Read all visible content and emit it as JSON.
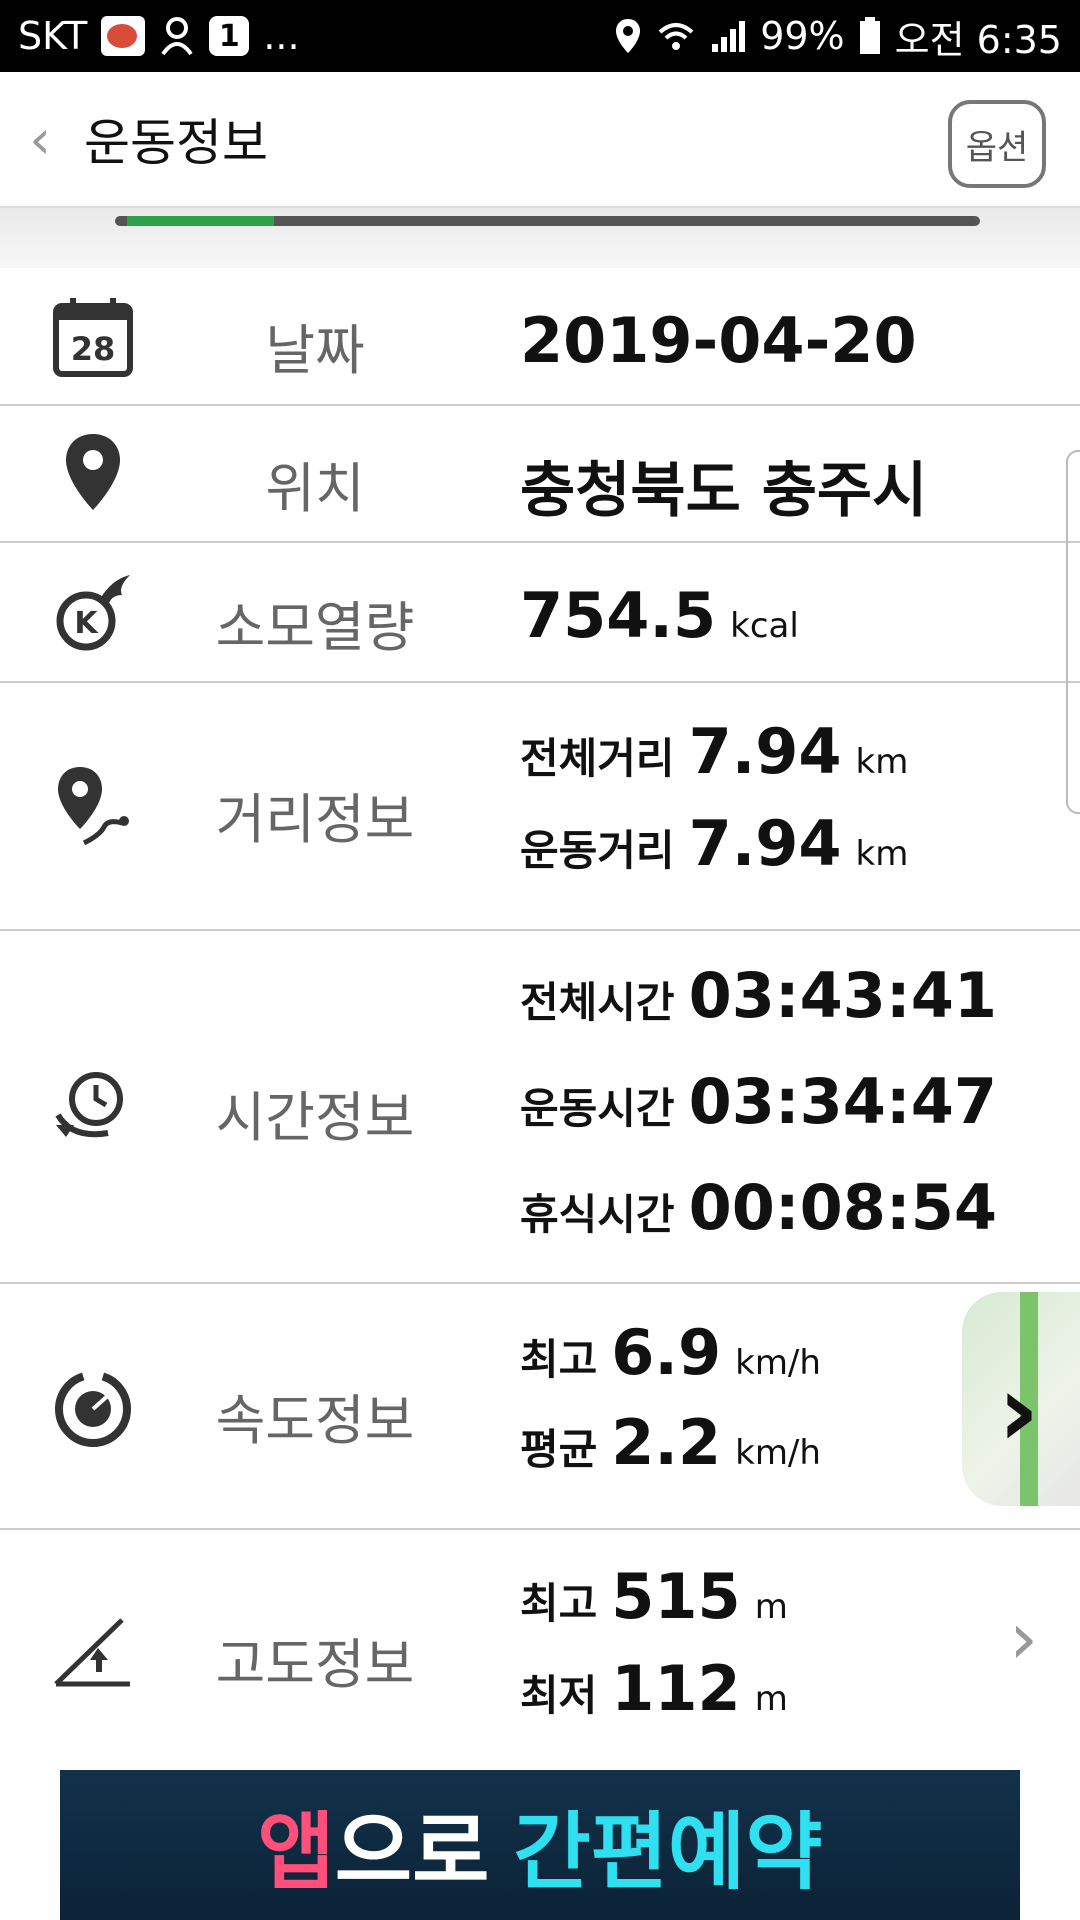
{
  "status_bar": {
    "carrier": "SKT",
    "badge_number": "1",
    "ellipsis": "...",
    "battery_percent": "99%",
    "time": "오전 6:35"
  },
  "header": {
    "back_symbol": "‹",
    "title": "운동정보",
    "option_label": "옵션"
  },
  "tab_progress": {
    "active_fraction": 0.17
  },
  "rows": {
    "date": {
      "icon": "calendar-icon",
      "icon_day": "28",
      "label": "날짜",
      "value": "2019-04-20"
    },
    "location": {
      "icon": "location-pin-icon",
      "label": "위치",
      "value": "충청북도 충주시"
    },
    "calories": {
      "icon": "calorie-flame-icon",
      "label": "소모열량",
      "value": "754.5",
      "unit": "kcal"
    },
    "distance": {
      "icon": "distance-route-icon",
      "label": "거리정보",
      "total_label": "전체거리",
      "total_value": "7.94",
      "total_unit": "km",
      "exercise_label": "운동거리",
      "exercise_value": "7.94",
      "exercise_unit": "km"
    },
    "time": {
      "icon": "clock-icon",
      "label": "시간정보",
      "total_label": "전체시간",
      "total_value": "03:43:41",
      "exercise_label": "운동시간",
      "exercise_value": "03:34:47",
      "rest_label": "휴식시간",
      "rest_value": "00:08:54"
    },
    "speed": {
      "icon": "speedometer-icon",
      "label": "속도정보",
      "max_label": "최고",
      "max_value": "6.9",
      "max_unit": "km/h",
      "avg_label": "평균",
      "avg_value": "2.2",
      "avg_unit": "km/h"
    },
    "altitude": {
      "icon": "altitude-icon",
      "label": "고도정보",
      "max_label": "최고",
      "max_value": "515",
      "max_unit": "m",
      "min_label": "최저",
      "min_value": "112",
      "min_unit": "m",
      "chevron": "›"
    }
  },
  "map_thumb": {
    "chevron": "›"
  },
  "banner": {
    "part1": "앱",
    "part2": "으로",
    "part3": "간편예약"
  },
  "colors": {
    "accent_green": "#2da14a",
    "banner_pink": "#ff4f7a",
    "banner_cyan": "#2ee0f0"
  }
}
